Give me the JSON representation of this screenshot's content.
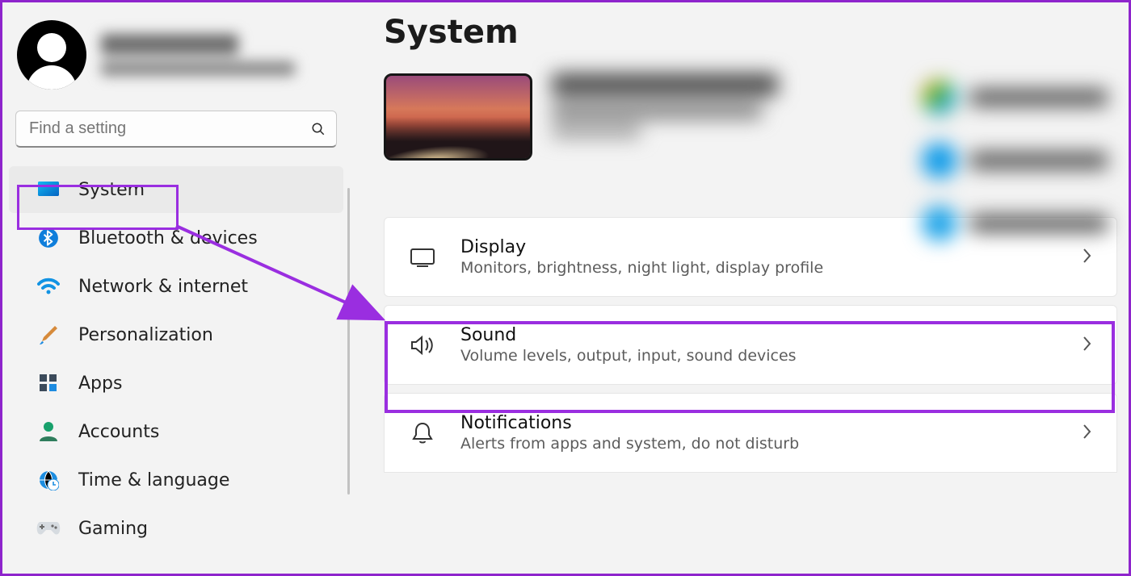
{
  "sidebar": {
    "search_placeholder": "Find a setting",
    "items": [
      {
        "id": "system",
        "label": "System"
      },
      {
        "id": "bluetooth",
        "label": "Bluetooth & devices"
      },
      {
        "id": "network",
        "label": "Network & internet"
      },
      {
        "id": "personalization",
        "label": "Personalization"
      },
      {
        "id": "apps",
        "label": "Apps"
      },
      {
        "id": "accounts",
        "label": "Accounts"
      },
      {
        "id": "time",
        "label": "Time & language"
      },
      {
        "id": "gaming",
        "label": "Gaming"
      }
    ]
  },
  "page": {
    "title": "System"
  },
  "cards": {
    "display": {
      "title": "Display",
      "desc": "Monitors, brightness, night light, display profile"
    },
    "sound": {
      "title": "Sound",
      "desc": "Volume levels, output, input, sound devices"
    },
    "notifications": {
      "title": "Notifications",
      "desc": "Alerts from apps and system, do not disturb"
    }
  },
  "annotation": {
    "color": "#9a2ee0"
  }
}
